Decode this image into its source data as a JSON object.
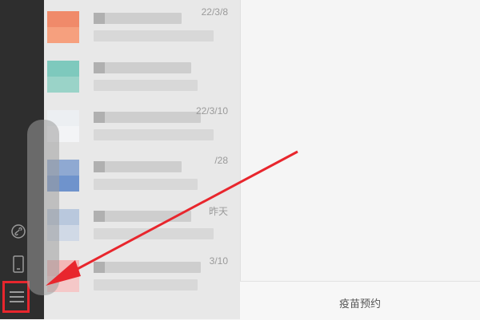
{
  "sidebar": {
    "icons": [
      {
        "name": "mini-program-icon",
        "interactable": true
      },
      {
        "name": "phone-icon",
        "interactable": true
      },
      {
        "name": "menu-icon",
        "interactable": true
      }
    ],
    "highlight_color": "#e8262d"
  },
  "chat_list": {
    "items": [
      {
        "time": "22/3/8",
        "avatar_colors": [
          "#f08a6a",
          "#f6a07e"
        ]
      },
      {
        "time": "",
        "avatar_colors": [
          "#7ec9bd",
          "#9ad3c8"
        ]
      },
      {
        "time": "22/3/10",
        "avatar_colors": [
          "#eceff2",
          "#f3f4f6"
        ]
      },
      {
        "time": "/28",
        "avatar_colors": [
          "#8fa9d2",
          "#6f93cc"
        ]
      },
      {
        "time": "昨天",
        "avatar_colors": [
          "#b9c8dd",
          "#d0d9e6"
        ]
      },
      {
        "time": "3/10",
        "avatar_colors": [
          "#f3b7b7",
          "#f5c8c8"
        ]
      }
    ]
  },
  "bottom_bar": {
    "label": "疫苗预约"
  },
  "annotation": {
    "arrow_color": "#e8262d"
  }
}
